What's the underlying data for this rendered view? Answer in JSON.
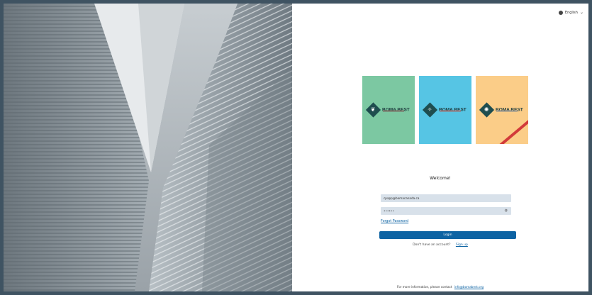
{
  "header": {
    "language_label": "English",
    "language_icon": "globe-icon",
    "dropdown_icon": "chevron-down-icon"
  },
  "cards": [
    {
      "brand": "BOMA BEST",
      "bg": "#7cc8a2",
      "accent": "#7a6b62",
      "symbol": "❦"
    },
    {
      "brand": "BOMA BEST",
      "bg": "#56c5e4",
      "accent": "#9e6f70",
      "symbol": "✧"
    },
    {
      "brand": "BOMA BEST",
      "bg": "#fbcd88",
      "accent": "#8a9090",
      "symbol": "✺"
    }
  ],
  "form": {
    "welcome": "Welcome!",
    "email_value": "cpapp@bomacanada.ca",
    "password_value": "••••••",
    "forgot_label": "Forgot Password",
    "login_label": "Login",
    "no_account_text": "Don't have an account?",
    "signup_label": "Sign up"
  },
  "footer": {
    "text": "For more information, please contact",
    "email": "info@bomabest.org"
  },
  "colors": {
    "primary": "#0d63a3",
    "field_bg": "#d8e1ea",
    "page_border": "#3f5362"
  }
}
